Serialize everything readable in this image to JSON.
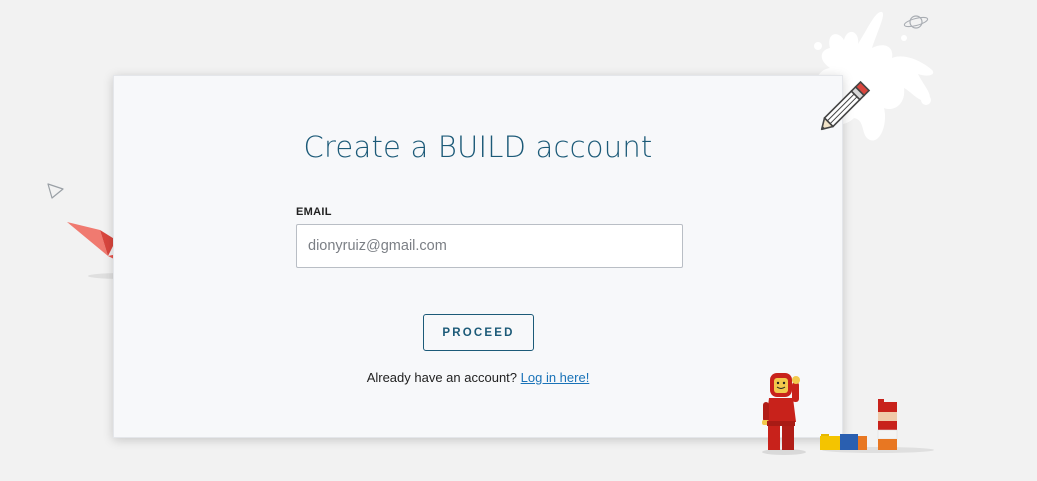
{
  "form": {
    "title": "Create a BUILD account",
    "email_label": "EMAIL",
    "email_value": "",
    "email_placeholder": "dionyruiz@gmail.com",
    "proceed_label": "PROCEED",
    "login_prompt": "Already have an account?",
    "login_link_label": "Log in here!"
  },
  "icons": [
    "planet-icon",
    "pencil-icon",
    "paint-splash-icon",
    "paper-plane-icon",
    "origami-bird-icon",
    "lego-astronaut-icon",
    "lego-bricks-icon"
  ],
  "colors": {
    "background": "#f2f2f2",
    "card": "#f7f8fa",
    "accent": "#1c5a78",
    "link": "#1a73b8",
    "bird": "#e8554e",
    "lego_red": "#c8221b"
  }
}
